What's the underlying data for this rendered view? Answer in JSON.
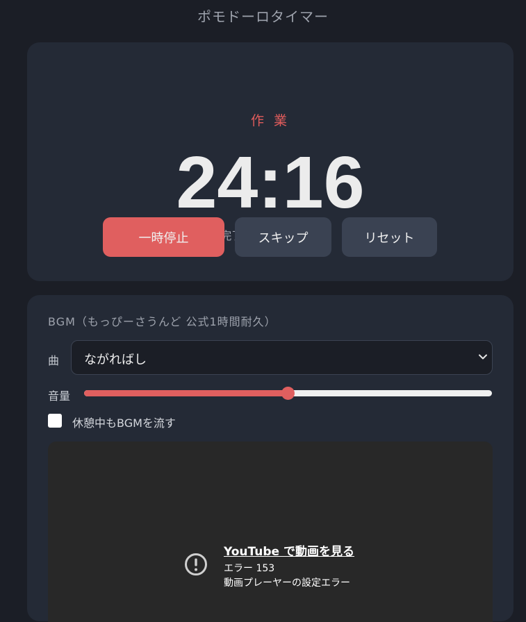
{
  "app": {
    "title": "ポモドーロタイマー"
  },
  "timer": {
    "mode": "作 業",
    "time": "24:16",
    "completed": "完了：0 ポモドーロ",
    "accent_color": "#e05f5f"
  },
  "controls": {
    "pause_label": "一時停止",
    "skip_label": "スキップ",
    "reset_label": "リセット"
  },
  "bgm": {
    "title": "BGM（もっぴーさうんど 公式1時間耐久）",
    "song_label": "曲",
    "song_selected": "ながればし",
    "volume_label": "音量",
    "volume_fraction": 0.5,
    "break_checkbox_label": "休憩中もBGMを流す",
    "break_checkbox_checked": false
  },
  "player": {
    "link_text": "YouTube で動画を見る",
    "error_code": "エラー 153",
    "error_message": "動画プレーヤーの設定エラー",
    "icon": "error-circle-icon"
  }
}
